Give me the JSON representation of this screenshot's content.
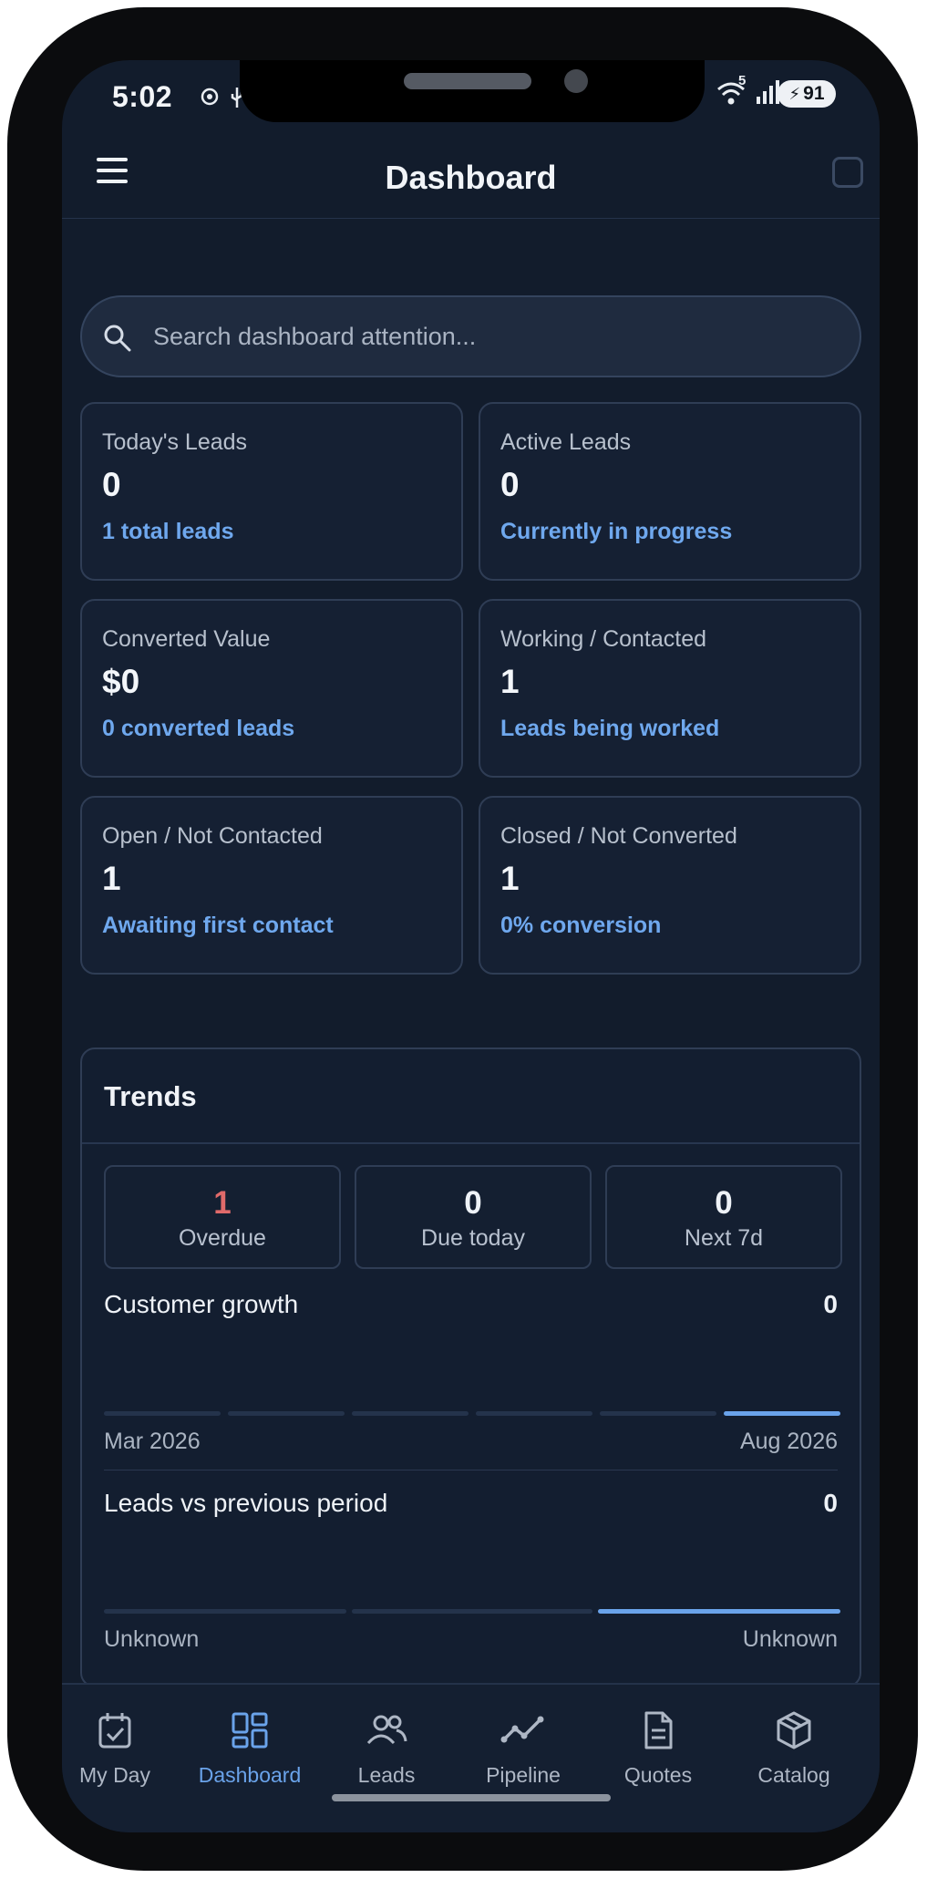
{
  "status_bar": {
    "time": "5:02",
    "battery": "91",
    "wifi_badge": "5"
  },
  "header": {
    "title": "Dashboard"
  },
  "search": {
    "placeholder": "Search dashboard attention..."
  },
  "cards": [
    {
      "label": "Today's Leads",
      "value": "0",
      "sub": "1 total leads"
    },
    {
      "label": "Active Leads",
      "value": "0",
      "sub": "Currently in progress"
    },
    {
      "label": "Converted Value",
      "value": "$0",
      "sub": "0 converted leads"
    },
    {
      "label": "Working / Contacted",
      "value": "1",
      "sub": "Leads being worked"
    },
    {
      "label": "Open / Not Contacted",
      "value": "1",
      "sub": "Awaiting first contact"
    },
    {
      "label": "Closed / Not Converted",
      "value": "1",
      "sub": "0% conversion"
    }
  ],
  "trends": {
    "title": "Trends",
    "stats": [
      {
        "value": "1",
        "label": "Overdue",
        "color": "#e06a6a"
      },
      {
        "value": "0",
        "label": "Due today",
        "color": "#eef2f7"
      },
      {
        "value": "0",
        "label": "Next 7d",
        "color": "#eef2f7"
      }
    ],
    "customer_growth": {
      "title": "Customer growth",
      "value": "0",
      "start": "Mar 2026",
      "end": "Aug 2026"
    },
    "leads_vs_previous": {
      "title": "Leads vs previous period",
      "value": "0",
      "start": "Unknown",
      "end": "Unknown"
    }
  },
  "nav": [
    {
      "label": "My Day",
      "icon": "calendar-check-icon",
      "active": false
    },
    {
      "label": "Dashboard",
      "icon": "dashboard-grid-icon",
      "active": true
    },
    {
      "label": "Leads",
      "icon": "people-icon",
      "active": false
    },
    {
      "label": "Pipeline",
      "icon": "trend-line-icon",
      "active": false
    },
    {
      "label": "Quotes",
      "icon": "document-icon",
      "active": false
    },
    {
      "label": "Catalog",
      "icon": "box-icon",
      "active": false
    }
  ],
  "colors": {
    "accent": "#6aa3ea",
    "background": "#121c2c",
    "overdue": "#e06a6a"
  }
}
